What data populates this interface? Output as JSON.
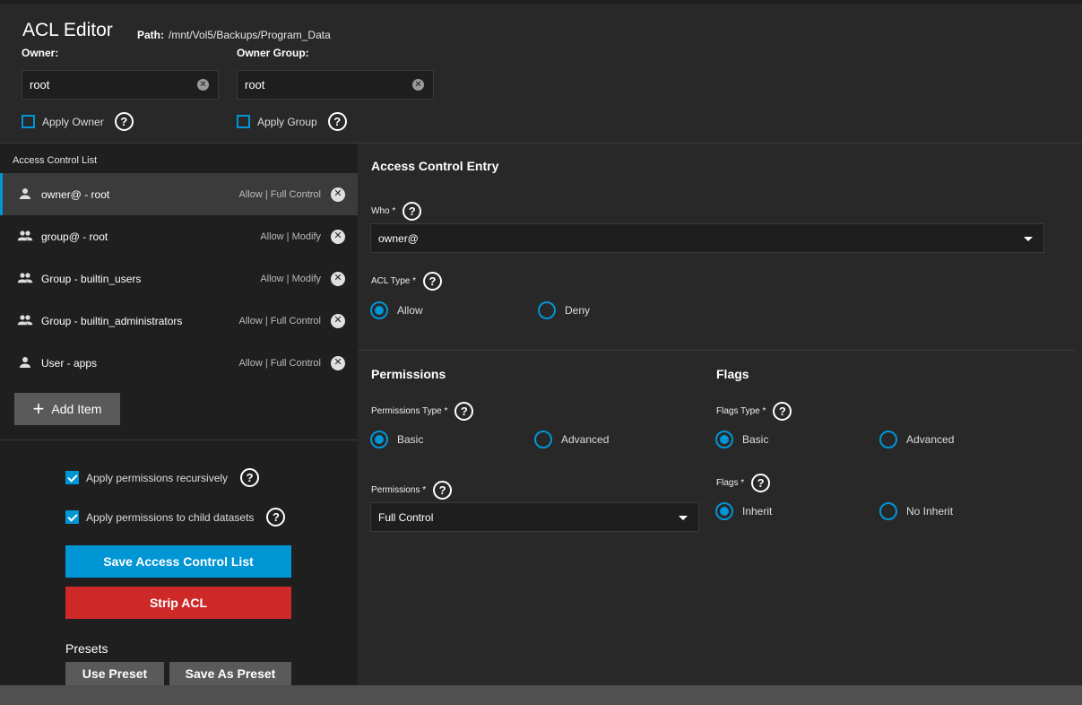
{
  "header": {
    "title": "ACL Editor",
    "path_label": "Path:",
    "path_value": "/mnt/Vol5/Backups/Program_Data"
  },
  "owner": {
    "label": "Owner:",
    "value": "root",
    "apply_label": "Apply Owner",
    "apply_checked": false
  },
  "owner_group": {
    "label": "Owner Group:",
    "value": "root",
    "apply_label": "Apply Group",
    "apply_checked": false
  },
  "acl_list": {
    "header": "Access Control List",
    "items": [
      {
        "name": "owner@ - root",
        "perm": "Allow | Full Control",
        "icon": "user-icon",
        "active": true
      },
      {
        "name": "group@ - root",
        "perm": "Allow | Modify",
        "icon": "group-icon",
        "active": false
      },
      {
        "name": "Group - builtin_users",
        "perm": "Allow | Modify",
        "icon": "group-icon",
        "active": false
      },
      {
        "name": "Group - builtin_administrators",
        "perm": "Allow | Full Control",
        "icon": "group-icon",
        "active": false
      },
      {
        "name": "User - apps",
        "perm": "Allow | Full Control",
        "icon": "user-icon",
        "active": false
      }
    ],
    "add_label": "Add Item"
  },
  "options": {
    "recursive_label": "Apply permissions recursively",
    "recursive_checked": true,
    "child_label": "Apply permissions to child datasets",
    "child_checked": true
  },
  "actions": {
    "save_label": "Save Access Control List",
    "strip_label": "Strip ACL",
    "presets_title": "Presets",
    "use_preset_label": "Use Preset",
    "save_preset_label": "Save As Preset"
  },
  "entry": {
    "title": "Access Control Entry",
    "who_label": "Who *",
    "who_value": "owner@",
    "acl_type_label": "ACL Type *",
    "allow_label": "Allow",
    "deny_label": "Deny",
    "acl_type_selected": "Allow"
  },
  "permissions": {
    "title": "Permissions",
    "type_label": "Permissions Type *",
    "basic_label": "Basic",
    "advanced_label": "Advanced",
    "type_selected": "Basic",
    "perm_label": "Permissions *",
    "perm_value": "Full Control"
  },
  "flags": {
    "title": "Flags",
    "type_label": "Flags Type *",
    "basic_label": "Basic",
    "advanced_label": "Advanced",
    "type_selected": "Basic",
    "flags_label": "Flags *",
    "inherit_label": "Inherit",
    "no_inherit_label": "No Inherit",
    "flags_selected": "Inherit"
  },
  "colors": {
    "accent": "#0095d5",
    "danger": "#ce2929",
    "background": "#282828",
    "panel": "#1f1f1f"
  }
}
